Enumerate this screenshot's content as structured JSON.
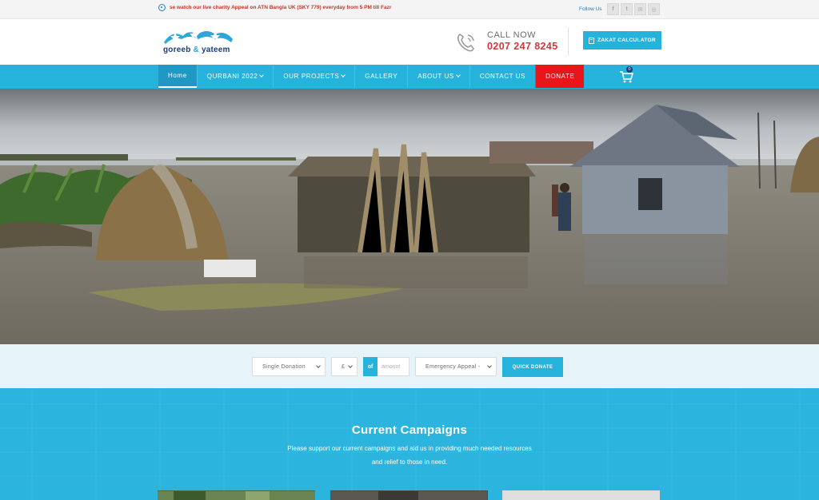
{
  "topbar": {
    "ticker": "se watch our live charity Appeal on ATN Bangla UK (SKY 779) everyday from 5 PM till Fazr",
    "follow_label": "Follow Us",
    "socials": [
      "f",
      "t",
      "✉",
      "◎"
    ]
  },
  "header": {
    "logo_text_left": "goreeb",
    "logo_text_amp": "&",
    "logo_text_right": "yateem",
    "call_label": "CALL NOW",
    "call_number": "0207 247 8245",
    "zakat_label": "ZAKAT CALCULATOR"
  },
  "nav": {
    "items": [
      {
        "label": "Home"
      },
      {
        "label": "QURBANI 2022"
      },
      {
        "label": "OUR PROJECTS"
      },
      {
        "label": "GALLERY"
      },
      {
        "label": "ABOUT US"
      },
      {
        "label": "CONTACT US"
      },
      {
        "label": "DONATE"
      }
    ],
    "cart_count": "0"
  },
  "donate_form": {
    "type_value": "Single Donation",
    "currency_value": "£",
    "of_label": "of",
    "amount_placeholder": "amount",
    "appeal_value": "Emergency Appeal -",
    "button_label": "QUICK DONATE"
  },
  "campaigns": {
    "title": "Current Campaigns",
    "subtitle_line1": "Please support our current campaigns and aid us in providing much needed resources",
    "subtitle_line2": "and relief to those in need."
  },
  "colors": {
    "brand_blue": "#25b3dc",
    "donate_red": "#e8151b",
    "phone_red": "#d9363e",
    "logo_navy": "#1d3c7a"
  }
}
